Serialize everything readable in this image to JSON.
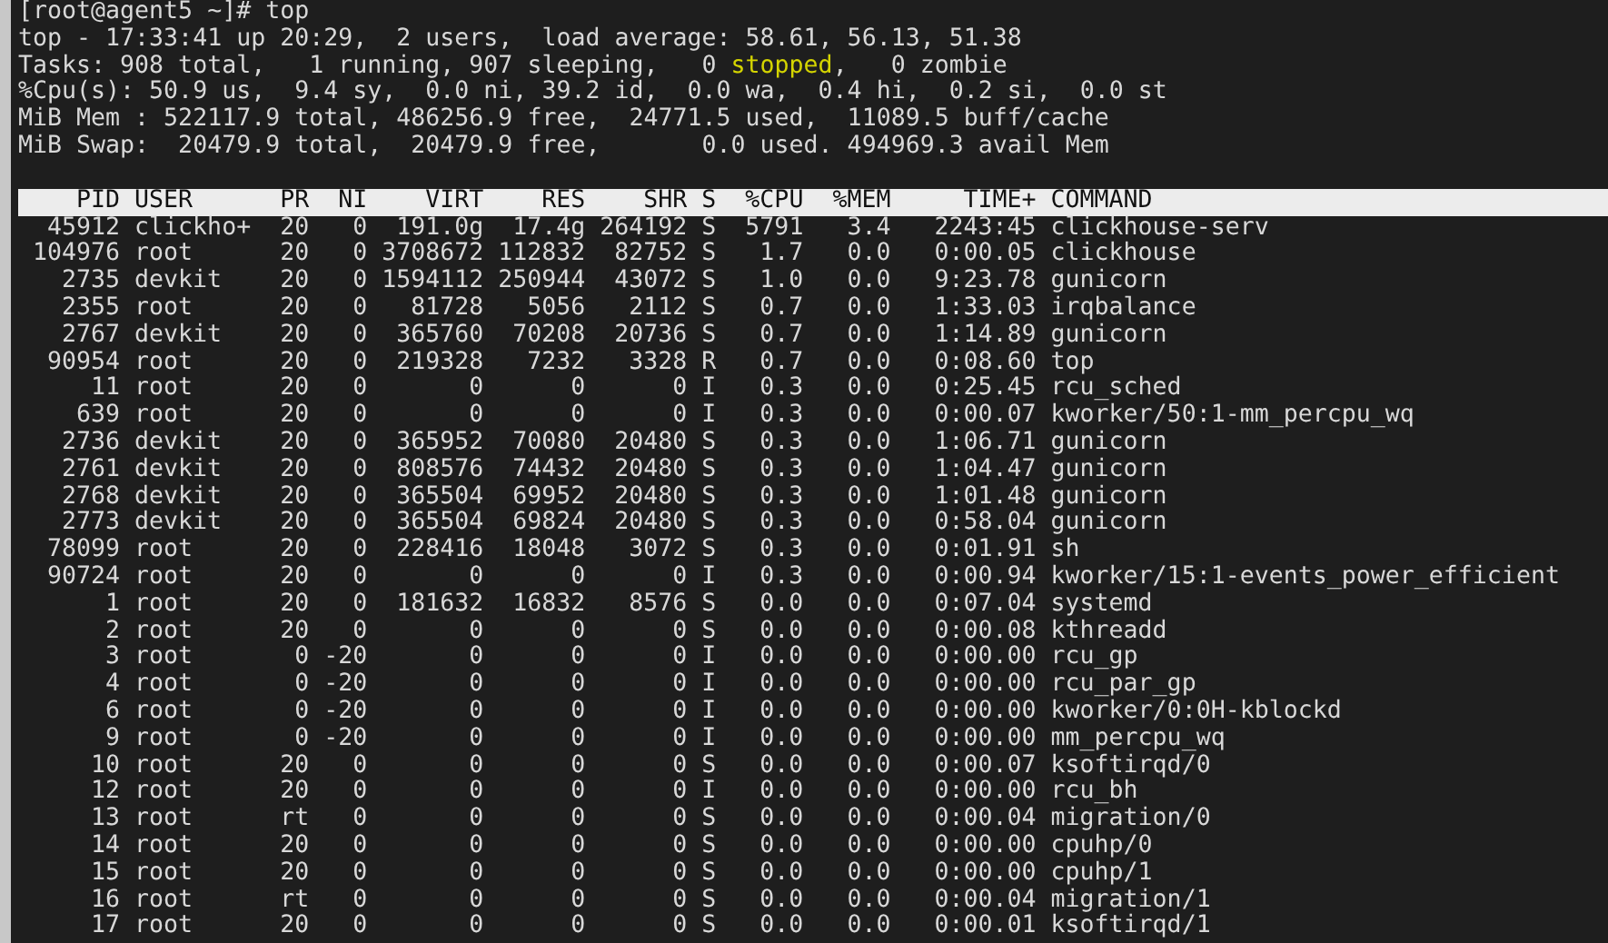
{
  "prompt": "[root@agent5 ~]# top",
  "summary": [
    [
      {
        "text": "top - 17:33:41 up 20:29,  2 users,  load average: 58.61, 56.13, 51.38",
        "highlight": false
      }
    ],
    [
      {
        "text": "Tasks: 908 total,   1 running, 907 sleeping,   0 ",
        "highlight": false
      },
      {
        "text": "stopped",
        "highlight": true
      },
      {
        "text": ",   0 zombie",
        "highlight": false
      }
    ],
    [
      {
        "text": "%Cpu(s): 50.9 us,  9.4 sy,  0.0 ni, 39.2 id,  0.0 wa,  0.4 hi,  0.2 si,  0.0 st",
        "highlight": false
      }
    ],
    [
      {
        "text": "MiB Mem : 522117.9 total, 486256.9 free,  24771.5 used,  11089.5 buff/cache",
        "highlight": false
      }
    ],
    [
      {
        "text": "MiB Swap:  20479.9 total,  20479.9 free,       0.0 used. 494969.3 avail Mem",
        "highlight": false
      }
    ]
  ],
  "table": {
    "columns": [
      "PID",
      "USER",
      "PR",
      "NI",
      "VIRT",
      "RES",
      "SHR",
      "S",
      "%CPU",
      "%MEM",
      "TIME+",
      "COMMAND"
    ],
    "rows": [
      [
        "45912",
        "clickho+",
        "20",
        "0",
        "191.0g",
        "17.4g",
        "264192",
        "S",
        "5791",
        "3.4",
        "2243:45",
        "clickhouse-serv"
      ],
      [
        "104976",
        "root",
        "20",
        "0",
        "3708672",
        "112832",
        "82752",
        "S",
        "1.7",
        "0.0",
        "0:00.05",
        "clickhouse"
      ],
      [
        "2735",
        "devkit",
        "20",
        "0",
        "1594112",
        "250944",
        "43072",
        "S",
        "1.0",
        "0.0",
        "9:23.78",
        "gunicorn"
      ],
      [
        "2355",
        "root",
        "20",
        "0",
        "81728",
        "5056",
        "2112",
        "S",
        "0.7",
        "0.0",
        "1:33.03",
        "irqbalance"
      ],
      [
        "2767",
        "devkit",
        "20",
        "0",
        "365760",
        "70208",
        "20736",
        "S",
        "0.7",
        "0.0",
        "1:14.89",
        "gunicorn"
      ],
      [
        "90954",
        "root",
        "20",
        "0",
        "219328",
        "7232",
        "3328",
        "R",
        "0.7",
        "0.0",
        "0:08.60",
        "top"
      ],
      [
        "11",
        "root",
        "20",
        "0",
        "0",
        "0",
        "0",
        "I",
        "0.3",
        "0.0",
        "0:25.45",
        "rcu_sched"
      ],
      [
        "639",
        "root",
        "20",
        "0",
        "0",
        "0",
        "0",
        "I",
        "0.3",
        "0.0",
        "0:00.07",
        "kworker/50:1-mm_percpu_wq"
      ],
      [
        "2736",
        "devkit",
        "20",
        "0",
        "365952",
        "70080",
        "20480",
        "S",
        "0.3",
        "0.0",
        "1:06.71",
        "gunicorn"
      ],
      [
        "2761",
        "devkit",
        "20",
        "0",
        "808576",
        "74432",
        "20480",
        "S",
        "0.3",
        "0.0",
        "1:04.47",
        "gunicorn"
      ],
      [
        "2768",
        "devkit",
        "20",
        "0",
        "365504",
        "69952",
        "20480",
        "S",
        "0.3",
        "0.0",
        "1:01.48",
        "gunicorn"
      ],
      [
        "2773",
        "devkit",
        "20",
        "0",
        "365504",
        "69824",
        "20480",
        "S",
        "0.3",
        "0.0",
        "0:58.04",
        "gunicorn"
      ],
      [
        "78099",
        "root",
        "20",
        "0",
        "228416",
        "18048",
        "3072",
        "S",
        "0.3",
        "0.0",
        "0:01.91",
        "sh"
      ],
      [
        "90724",
        "root",
        "20",
        "0",
        "0",
        "0",
        "0",
        "I",
        "0.3",
        "0.0",
        "0:00.94",
        "kworker/15:1-events_power_efficient"
      ],
      [
        "1",
        "root",
        "20",
        "0",
        "181632",
        "16832",
        "8576",
        "S",
        "0.0",
        "0.0",
        "0:07.04",
        "systemd"
      ],
      [
        "2",
        "root",
        "20",
        "0",
        "0",
        "0",
        "0",
        "S",
        "0.0",
        "0.0",
        "0:00.08",
        "kthreadd"
      ],
      [
        "3",
        "root",
        "0",
        "-20",
        "0",
        "0",
        "0",
        "I",
        "0.0",
        "0.0",
        "0:00.00",
        "rcu_gp"
      ],
      [
        "4",
        "root",
        "0",
        "-20",
        "0",
        "0",
        "0",
        "I",
        "0.0",
        "0.0",
        "0:00.00",
        "rcu_par_gp"
      ],
      [
        "6",
        "root",
        "0",
        "-20",
        "0",
        "0",
        "0",
        "I",
        "0.0",
        "0.0",
        "0:00.00",
        "kworker/0:0H-kblockd"
      ],
      [
        "9",
        "root",
        "0",
        "-20",
        "0",
        "0",
        "0",
        "I",
        "0.0",
        "0.0",
        "0:00.00",
        "mm_percpu_wq"
      ],
      [
        "10",
        "root",
        "20",
        "0",
        "0",
        "0",
        "0",
        "S",
        "0.0",
        "0.0",
        "0:00.07",
        "ksoftirqd/0"
      ],
      [
        "12",
        "root",
        "20",
        "0",
        "0",
        "0",
        "0",
        "I",
        "0.0",
        "0.0",
        "0:00.00",
        "rcu_bh"
      ],
      [
        "13",
        "root",
        "rt",
        "0",
        "0",
        "0",
        "0",
        "S",
        "0.0",
        "0.0",
        "0:00.04",
        "migration/0"
      ],
      [
        "14",
        "root",
        "20",
        "0",
        "0",
        "0",
        "0",
        "S",
        "0.0",
        "0.0",
        "0:00.00",
        "cpuhp/0"
      ],
      [
        "15",
        "root",
        "20",
        "0",
        "0",
        "0",
        "0",
        "S",
        "0.0",
        "0.0",
        "0:00.00",
        "cpuhp/1"
      ],
      [
        "16",
        "root",
        "rt",
        "0",
        "0",
        "0",
        "0",
        "S",
        "0.0",
        "0.0",
        "0:00.04",
        "migration/1"
      ],
      [
        "17",
        "root",
        "20",
        "0",
        "0",
        "0",
        "0",
        "S",
        "0.0",
        "0.0",
        "0:00.01",
        "ksoftirqd/1"
      ]
    ]
  }
}
